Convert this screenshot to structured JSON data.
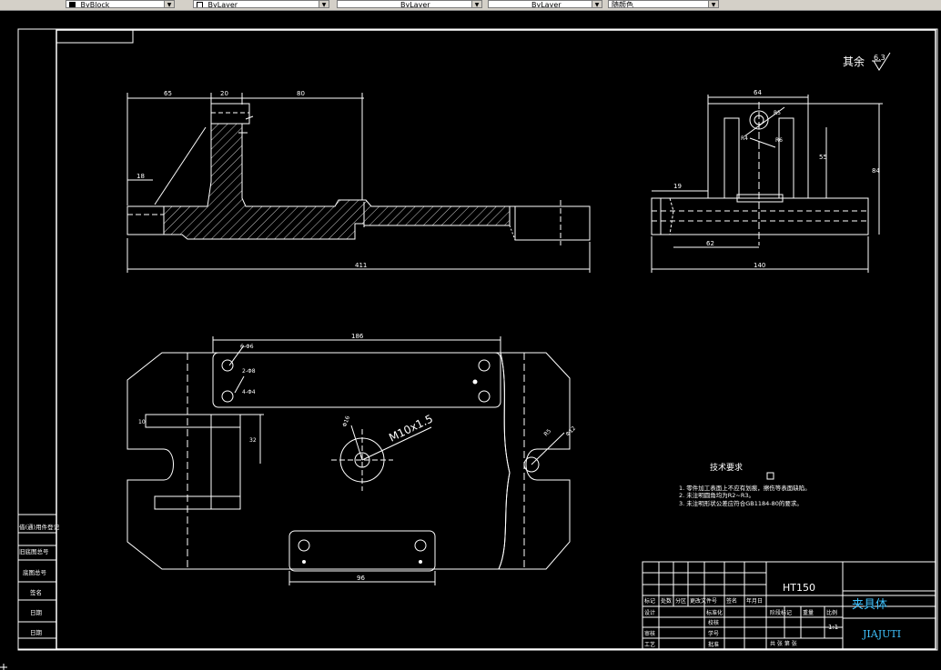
{
  "toolbar": {
    "items": [
      {
        "icon": "color-swatch-icon",
        "text": "ByBlock"
      },
      {
        "icon": "layer-icon",
        "text": "ByLayer"
      },
      {
        "icon": "",
        "text": "ByLayer"
      },
      {
        "icon": "",
        "text": "ByLayer"
      },
      {
        "icon": "",
        "text": "随颜色"
      }
    ]
  },
  "drawing": {
    "roughness_note": "其余",
    "roughness_value": "6.3",
    "front_view": {
      "dim_top_left": "65",
      "dim_top_mid": "20",
      "dim_top_right": "80",
      "dim_side": "18",
      "dim_overall": "411"
    },
    "side_view": {
      "dim_top": "64",
      "dim_height_inner": "55",
      "dim_height_outer": "84",
      "dim_left": "19",
      "dim_bottom_inner": "62",
      "dim_overall": "140",
      "hole_label_a": "R4",
      "hole_label_b": "R5",
      "hole_label_c": "R6"
    },
    "plan_view": {
      "dim_top": "186",
      "dim_bottom": "96",
      "dim_left_a": "10",
      "dim_left_b": "32",
      "label_holes_a": "6-Φ6",
      "label_holes_b": "2-Φ8",
      "label_holes_c": "4-Φ4",
      "thread_label": "M10x1.5",
      "thread_dia": "Φ16",
      "slot_r": "R5",
      "slot_w": "Φ12"
    },
    "notes": {
      "title": "技术要求",
      "lines": [
        "1. 零件加工表面上不应有划痕，擦伤等表面缺陷。",
        "2. 未注明圆角均为R2~R3。",
        "3. 未注明形状公差应符合GB1184-80的要求。"
      ]
    },
    "title_block": {
      "material": "HT150",
      "part_name": "夹具体",
      "drawing_no": "JIAJUTI",
      "scale": "1:1",
      "row_labels": [
        "标记",
        "处数",
        "分区",
        "更改文件号",
        "签名",
        "年月日"
      ],
      "designer": "设计",
      "standard": "标准化",
      "stage": "阶段标记",
      "weight": "重量",
      "ratio": "比例",
      "review": "审核",
      "process": "工艺",
      "approve": "批准",
      "check": "校核",
      "sign": "学号",
      "sheets": "共  张  第  张"
    },
    "side_table": [
      "借(通)用件登记",
      "旧底图总号",
      "底图总号",
      "签名",
      "日期",
      "日期"
    ]
  }
}
